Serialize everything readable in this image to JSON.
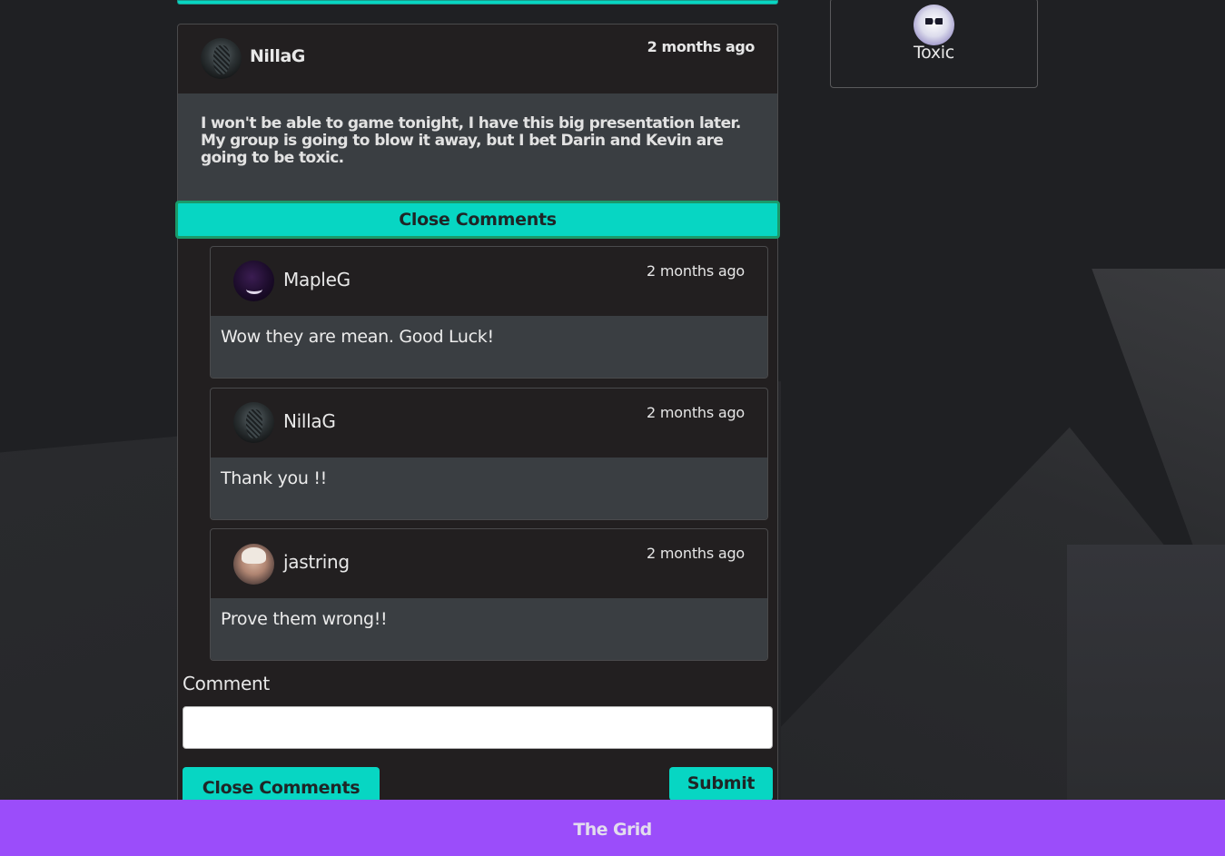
{
  "post": {
    "author": "NillaG",
    "time": "2 months ago",
    "text": "I won't be able to game tonight, I have this big presentation later. My group is going to blow it away, but I bet Darin and Kevin are going to be toxic."
  },
  "close_comments_top": "Close Comments",
  "comments": [
    {
      "author": "MapleG",
      "time": "2 months ago",
      "text": "Wow they are mean. Good Luck!"
    },
    {
      "author": "NillaG",
      "time": "2 months ago",
      "text": "Thank you !!"
    },
    {
      "author": "jastring",
      "time": "2 months ago",
      "text": "Prove them wrong!!"
    }
  ],
  "comment_form": {
    "label": "Comment",
    "value": "",
    "close_label": "Close Comments",
    "submit_label": "Submit"
  },
  "sidebar": {
    "user_name": "Toxic"
  },
  "footer": {
    "brand": "The Grid"
  },
  "colors": {
    "accent": "#07d6c3",
    "footer": "#9b4dfa",
    "card": "#221f20",
    "card_body": "#3a3e42"
  }
}
